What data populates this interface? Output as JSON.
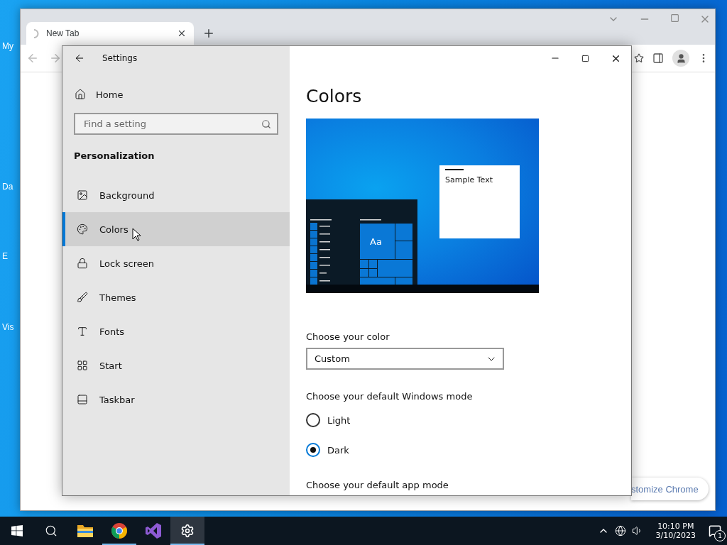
{
  "desktop": {
    "icons": [
      {
        "label": "My"
      },
      {
        "label": "Da"
      },
      {
        "label": "E"
      },
      {
        "label": "Vis"
      }
    ]
  },
  "browser": {
    "tabs": [
      {
        "label": "New Tab",
        "selected": true
      }
    ],
    "customize_button": "stomize Chrome"
  },
  "settings": {
    "title": "Settings",
    "home": "Home",
    "search": {
      "placeholder": "Find a setting"
    },
    "section": "Personalization",
    "nav": [
      {
        "label": "Background",
        "kind": "picture",
        "selected": false
      },
      {
        "label": "Colors",
        "kind": "palette",
        "selected": true
      },
      {
        "label": "Lock screen",
        "kind": "lock",
        "selected": false
      },
      {
        "label": "Themes",
        "kind": "brush",
        "selected": false
      },
      {
        "label": "Fonts",
        "kind": "font",
        "selected": false
      },
      {
        "label": "Start",
        "kind": "start",
        "selected": false
      },
      {
        "label": "Taskbar",
        "kind": "taskbar",
        "selected": false
      }
    ],
    "page_title": "Colors",
    "preview": {
      "tile_label": "Aa",
      "sample_text": "Sample Text"
    },
    "color_label": "Choose your color",
    "color_value": "Custom",
    "mode_label": "Choose your default Windows mode",
    "modes": [
      {
        "label": "Light",
        "selected": false
      },
      {
        "label": "Dark",
        "selected": true
      }
    ],
    "app_mode_label": "Choose your default app mode"
  },
  "taskbar": {
    "apps": [
      {
        "kind": "start",
        "running": false,
        "active": false
      },
      {
        "kind": "search",
        "running": false,
        "active": false
      },
      {
        "kind": "explorer",
        "running": false,
        "active": false
      },
      {
        "kind": "chrome",
        "running": true,
        "active": false
      },
      {
        "kind": "studio",
        "running": false,
        "active": false
      },
      {
        "kind": "settings",
        "running": true,
        "active": true
      }
    ],
    "time": "10:10 PM",
    "date": "3/10/2023",
    "notification_count": "1"
  }
}
